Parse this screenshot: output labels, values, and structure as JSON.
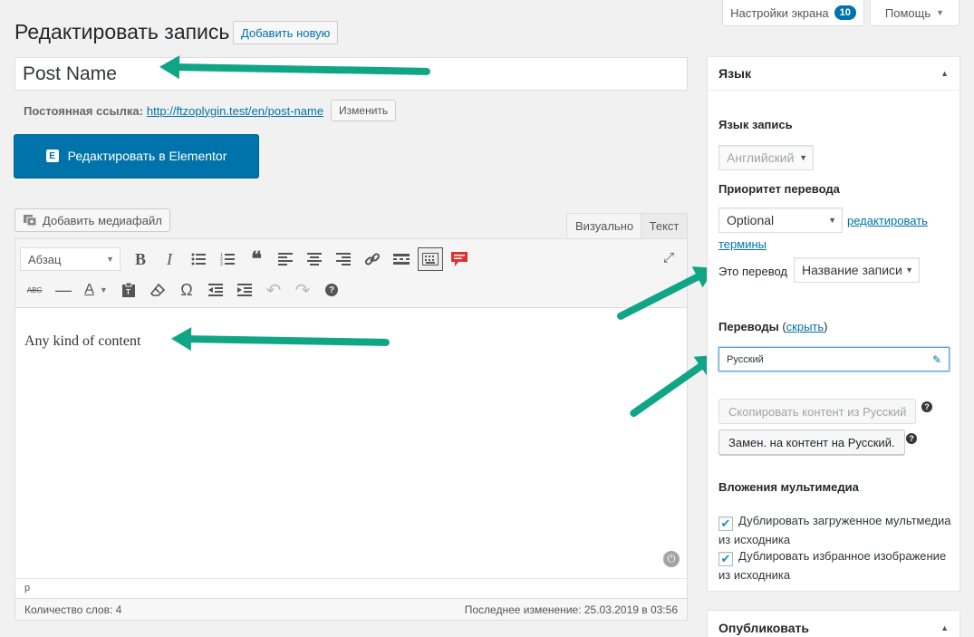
{
  "screen_meta": {
    "screen_options_label": "Настройки экрана",
    "screen_options_count": "10",
    "help_label": "Помощь"
  },
  "header": {
    "title": "Редактировать запись",
    "add_new_label": "Добавить новую"
  },
  "post": {
    "title_value": "Post Name",
    "permalink_label": "Постоянная ссылка:",
    "permalink_base": "http://ftzoplygin.test/en/",
    "permalink_slug": "post-name",
    "permalink_edit_label": "Изменить",
    "elementor_label": "Редактировать в Elementor",
    "elementor_logo": "E"
  },
  "editor": {
    "add_media_label": "Добавить медиафайл",
    "tab_visual": "Визуально",
    "tab_text": "Текст",
    "format_select": "Абзац",
    "content": "Any kind of content",
    "path": "p",
    "word_count": "Количество слов: 4",
    "last_edit": "Последнее изменение: 25.03.2019 в 03:56"
  },
  "icons": {
    "bold": "B",
    "italic": "I",
    "bullet_list": "☰",
    "numbered_list": "≡",
    "blockquote": "❝",
    "align_left": "≡",
    "align_center": "≡",
    "align_right": "≡",
    "link": "🔗",
    "read_more": "▭",
    "toolbar_toggle": "⌨",
    "comment": "💬",
    "strikethrough": "ABC",
    "hr": "—",
    "text_color": "A",
    "paste_text": "📋",
    "clear_format": "⌫",
    "special_char": "Ω",
    "outdent": "⇤",
    "indent": "⇥",
    "undo": "↶",
    "redo": "↷",
    "help": "?",
    "fullscreen": "⤢",
    "power": "⏻"
  },
  "language_box": {
    "title": "Язык",
    "lang_label": "Язык запись",
    "lang_value": "Английский",
    "priority_label": "Приоритет перевода",
    "priority_value": "Optional",
    "edit_terms_link": "редактировать",
    "edit_terms_link2": "термины",
    "this_is_translation_label": "Это перевод",
    "this_is_translation_value": "Название записи",
    "translations_label": "Переводы",
    "translations_hide_link": "скрыть",
    "translation_value": "Русский",
    "copy_button": "Скопировать контент из Русский",
    "replace_button": "Замен. на контент на Русский.",
    "media_label": "Вложения мультимедиа",
    "dup_uploaded": "Дублировать загруженное мультмедиа из исходника",
    "dup_featured": "Дублировать избранное изображение из исходника"
  },
  "publish_box": {
    "title": "Опубликовать"
  },
  "colors": {
    "accent": "#0073aa",
    "arrow": "#10a584"
  }
}
